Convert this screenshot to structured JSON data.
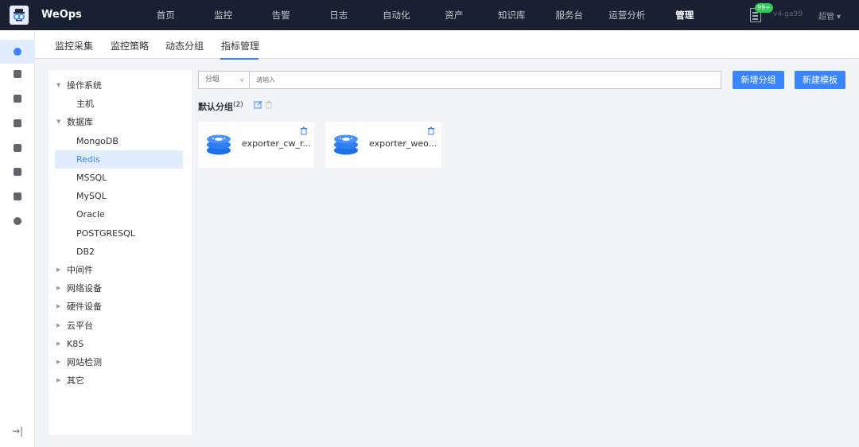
{
  "app": {
    "name": "WeOps"
  },
  "topnav": {
    "items": [
      "首页",
      "监控",
      "告警",
      "日志",
      "自动化",
      "资产",
      "知识库",
      "服务台",
      "运营分析",
      "管理"
    ],
    "active": "管理",
    "notification_badge": "99+",
    "version": "v4-ga99",
    "user": "超管 ▾"
  },
  "tabs": {
    "items": [
      "监控采集",
      "监控策略",
      "动态分组",
      "指标管理"
    ],
    "active": "指标管理"
  },
  "tree": {
    "nodes": [
      {
        "label": "操作系统",
        "arrow": "▼",
        "child": false
      },
      {
        "label": "主机",
        "child": true
      },
      {
        "label": "数据库",
        "arrow": "▼",
        "child": false
      },
      {
        "label": "MongoDB",
        "child": true
      },
      {
        "label": "Redis",
        "child": true,
        "selected": true
      },
      {
        "label": "MSSQL",
        "child": true
      },
      {
        "label": "MySQL",
        "child": true
      },
      {
        "label": "Oracle",
        "child": true
      },
      {
        "label": "POSTGRESQL",
        "child": true
      },
      {
        "label": "DB2",
        "child": true
      },
      {
        "label": "中间件",
        "arrow": "▶",
        "child": false
      },
      {
        "label": "网络设备",
        "arrow": "▶",
        "child": false
      },
      {
        "label": "硬件设备",
        "arrow": "▶",
        "child": false
      },
      {
        "label": "云平台",
        "arrow": "▶",
        "child": false
      },
      {
        "label": "K8S",
        "arrow": "▶",
        "child": false
      },
      {
        "label": "网站检测",
        "arrow": "▶",
        "child": false
      },
      {
        "label": "其它",
        "arrow": "▶",
        "child": false
      }
    ]
  },
  "search": {
    "select_value": "分组",
    "placeholder": "请输入"
  },
  "buttons": {
    "add_group": "新增分组",
    "new_template": "新建模板"
  },
  "group": {
    "title": "默认分组",
    "count": "(2)"
  },
  "cards": [
    {
      "name": "exporter_cw_r..."
    },
    {
      "name": "exporter_weo..."
    }
  ],
  "colors": {
    "accent": "#3a84ff",
    "topbar": "#182132",
    "badge": "#2dcb56"
  }
}
